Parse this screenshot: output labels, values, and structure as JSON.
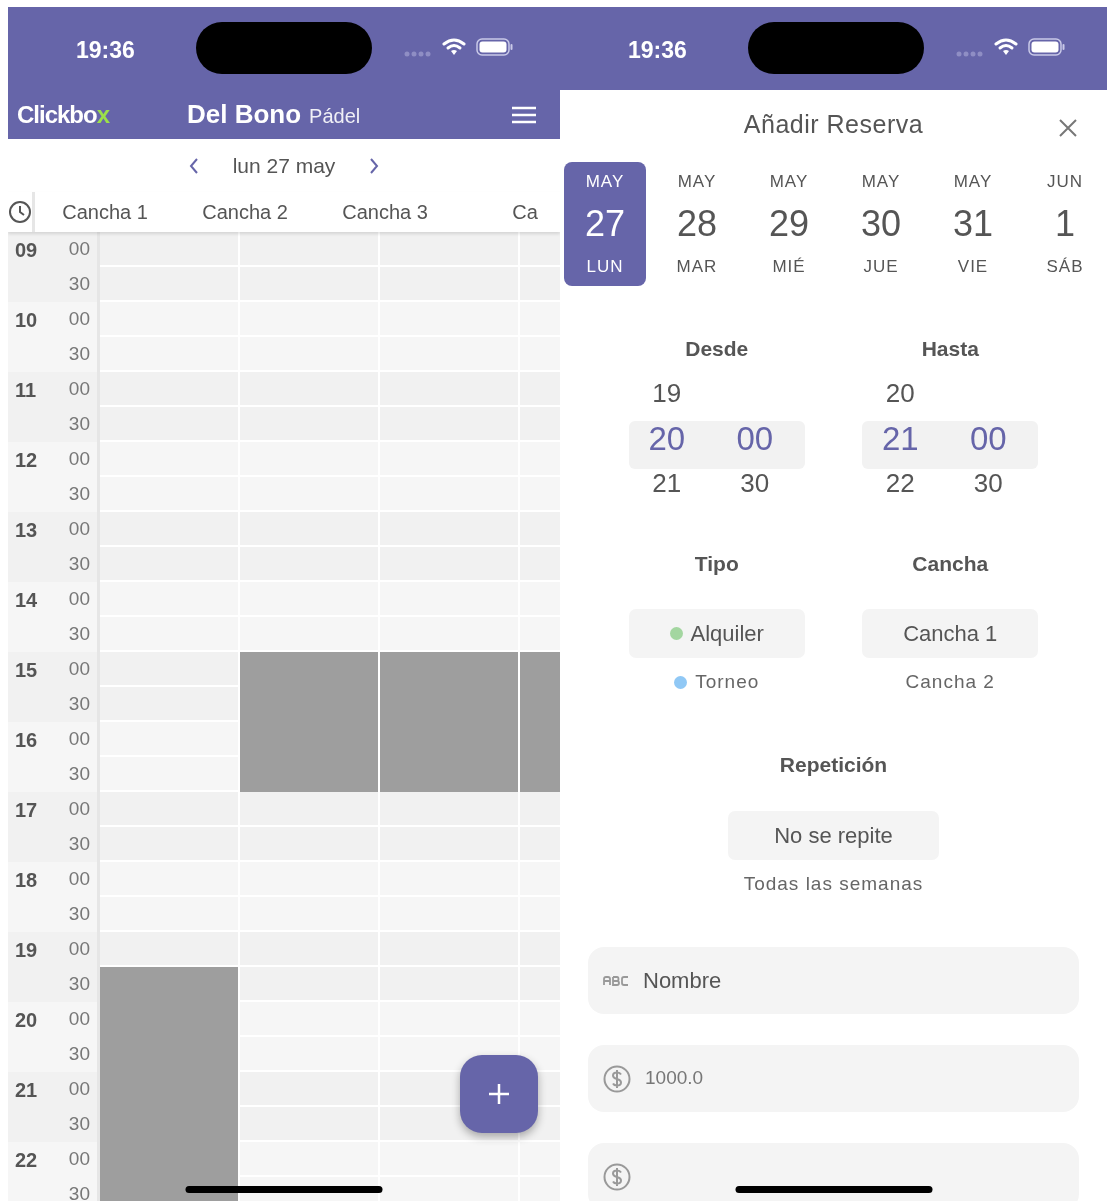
{
  "left_screen": {
    "status_bar": {
      "time": "19:36"
    },
    "app_bar": {
      "logo": "Clickbox",
      "title": "Del Bono",
      "subtitle": "Pádel"
    },
    "date_nav": {
      "date": "lun 27 may"
    },
    "courts": [
      "Cancha 1",
      "Cancha 2",
      "Cancha 3",
      "Ca"
    ],
    "hours": [
      {
        "hour": "09",
        "slots": [
          {
            "minute": "00",
            "booked": [
              false,
              false,
              false,
              false
            ]
          },
          {
            "minute": "30",
            "booked": [
              false,
              false,
              false,
              false
            ]
          }
        ]
      },
      {
        "hour": "10",
        "slots": [
          {
            "minute": "00",
            "booked": [
              false,
              false,
              false,
              false
            ]
          },
          {
            "minute": "30",
            "booked": [
              false,
              false,
              false,
              false
            ]
          }
        ]
      },
      {
        "hour": "11",
        "slots": [
          {
            "minute": "00",
            "booked": [
              false,
              false,
              false,
              false
            ]
          },
          {
            "minute": "30",
            "booked": [
              false,
              false,
              false,
              false
            ]
          }
        ]
      },
      {
        "hour": "12",
        "slots": [
          {
            "minute": "00",
            "booked": [
              false,
              false,
              false,
              false
            ]
          },
          {
            "minute": "30",
            "booked": [
              false,
              false,
              false,
              false
            ]
          }
        ]
      },
      {
        "hour": "13",
        "slots": [
          {
            "minute": "00",
            "booked": [
              false,
              false,
              false,
              false
            ]
          },
          {
            "minute": "30",
            "booked": [
              false,
              false,
              false,
              false
            ]
          }
        ]
      },
      {
        "hour": "14",
        "slots": [
          {
            "minute": "00",
            "booked": [
              false,
              false,
              false,
              false
            ]
          },
          {
            "minute": "30",
            "booked": [
              false,
              false,
              false,
              false
            ]
          }
        ]
      },
      {
        "hour": "15",
        "slots": [
          {
            "minute": "00",
            "booked": [
              false,
              true,
              true,
              true
            ]
          },
          {
            "minute": "30",
            "booked": [
              false,
              true,
              true,
              true
            ]
          }
        ]
      },
      {
        "hour": "16",
        "slots": [
          {
            "minute": "00",
            "booked": [
              false,
              true,
              true,
              true
            ]
          },
          {
            "minute": "30",
            "booked": [
              false,
              true,
              true,
              true
            ]
          }
        ]
      },
      {
        "hour": "17",
        "slots": [
          {
            "minute": "00",
            "booked": [
              false,
              false,
              false,
              false
            ]
          },
          {
            "minute": "30",
            "booked": [
              false,
              false,
              false,
              false
            ]
          }
        ]
      },
      {
        "hour": "18",
        "slots": [
          {
            "minute": "00",
            "booked": [
              false,
              false,
              false,
              false
            ]
          },
          {
            "minute": "30",
            "booked": [
              false,
              false,
              false,
              false
            ]
          }
        ]
      },
      {
        "hour": "19",
        "slots": [
          {
            "minute": "00",
            "booked": [
              false,
              false,
              false,
              false
            ]
          },
          {
            "minute": "30",
            "booked": [
              true,
              false,
              false,
              false
            ]
          }
        ]
      },
      {
        "hour": "20",
        "slots": [
          {
            "minute": "00",
            "booked": [
              true,
              false,
              false,
              false
            ]
          },
          {
            "minute": "30",
            "booked": [
              true,
              false,
              false,
              false
            ]
          }
        ]
      },
      {
        "hour": "21",
        "slots": [
          {
            "minute": "00",
            "booked": [
              true,
              false,
              false,
              false
            ]
          },
          {
            "minute": "30",
            "booked": [
              true,
              false,
              false,
              false
            ]
          }
        ]
      },
      {
        "hour": "22",
        "slots": [
          {
            "minute": "00",
            "booked": [
              true,
              false,
              false,
              false
            ]
          },
          {
            "minute": "30",
            "booked": [
              true,
              false,
              false,
              false
            ]
          }
        ]
      }
    ]
  },
  "right_screen": {
    "status_bar": {
      "time": "19:36"
    },
    "dialog": {
      "title": "Añadir Reserva",
      "days": [
        {
          "month": "MAY",
          "day": "27",
          "weekday": "LUN",
          "selected": true
        },
        {
          "month": "MAY",
          "day": "28",
          "weekday": "MAR",
          "selected": false
        },
        {
          "month": "MAY",
          "day": "29",
          "weekday": "MIÉ",
          "selected": false
        },
        {
          "month": "MAY",
          "day": "30",
          "weekday": "JUE",
          "selected": false
        },
        {
          "month": "MAY",
          "day": "31",
          "weekday": "VIE",
          "selected": false
        },
        {
          "month": "JUN",
          "day": "1",
          "weekday": "SÁB",
          "selected": false
        }
      ],
      "time_pickers": [
        {
          "label": "Desde",
          "hours": [
            {
              "value": "19",
              "selected": false
            },
            {
              "value": "20",
              "selected": true
            },
            {
              "value": "21",
              "selected": false
            }
          ],
          "minutes": [
            {
              "value": "00",
              "selected": true
            },
            {
              "value": "30",
              "selected": false
            }
          ]
        },
        {
          "label": "Hasta",
          "hours": [
            {
              "value": "20",
              "selected": false
            },
            {
              "value": "21",
              "selected": true
            },
            {
              "value": "22",
              "selected": false
            }
          ],
          "minutes": [
            {
              "value": "00",
              "selected": true
            },
            {
              "value": "30",
              "selected": false
            }
          ]
        }
      ],
      "choices": [
        {
          "label": "Tipo",
          "options": [
            {
              "text": "Alquiler",
              "color": "#a3d6a0",
              "selected": true
            },
            {
              "text": "Torneo",
              "color": "#90c8f5",
              "selected": false
            }
          ]
        },
        {
          "label": "Cancha",
          "options": [
            {
              "text": "Cancha 1",
              "selected": true
            },
            {
              "text": "Cancha 2",
              "selected": false
            }
          ]
        }
      ],
      "repeat": {
        "label": "Repetición",
        "options": [
          {
            "text": "No se repite",
            "selected": true
          },
          {
            "text": "Todas las semanas",
            "selected": false
          }
        ]
      },
      "fields": [
        {
          "kind": "text",
          "placeholder": "Nombre"
        },
        {
          "kind": "currency",
          "value": "1000.0"
        },
        {
          "kind": "currency"
        }
      ]
    }
  }
}
